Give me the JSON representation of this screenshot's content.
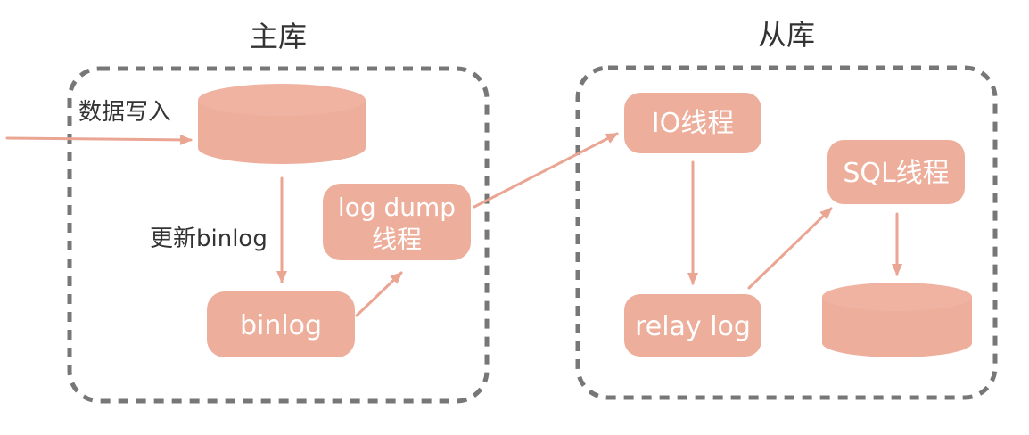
{
  "groups": {
    "master_title": "主库",
    "slave_title": "从库"
  },
  "labels": {
    "data_write": "数据写入",
    "update_binlog": "更新binlog"
  },
  "nodes": {
    "binlog": "binlog",
    "log_dump_line1": "log  dump",
    "log_dump_line2": "线程",
    "io_thread": "IO线程",
    "relay_log": "relay log",
    "sql_thread": "SQL线程"
  },
  "colors": {
    "node_fill": "#EDAE9B",
    "node_top": "#F0B3A1",
    "arrow": "#EAA593",
    "border": "#777777",
    "title_text": "#333333"
  }
}
